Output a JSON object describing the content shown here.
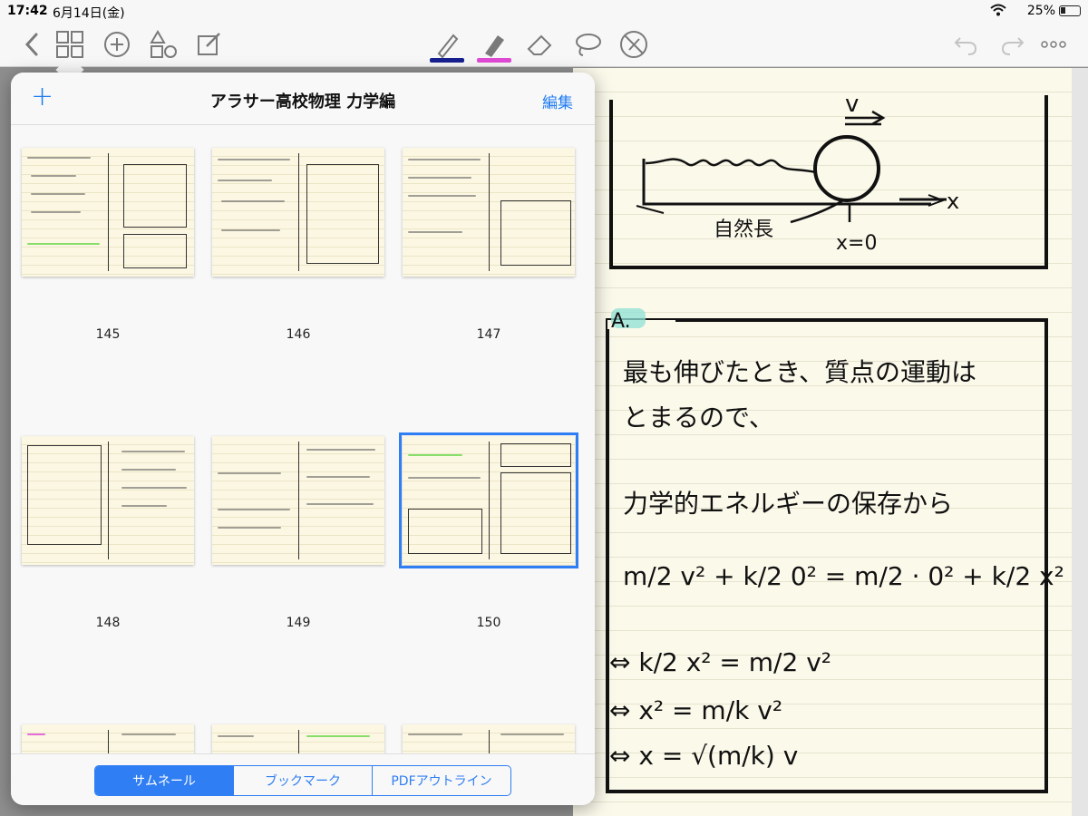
{
  "status_bar": {
    "time": "17:42",
    "date": "6月14日(金)",
    "battery": "25%"
  },
  "toolbar": {
    "icons": [
      "back-icon",
      "grid-icon",
      "add-page-icon",
      "shapes-icon",
      "edit-icon",
      "pen-icon",
      "highlighter-icon",
      "eraser-icon",
      "lasso-icon",
      "no-touch-icon",
      "undo-icon",
      "redo-icon",
      "more-icon"
    ],
    "pen_color": "#17208f",
    "highlighter_color": "#e04ad6"
  },
  "popover": {
    "add_label": "+",
    "title": "アラサー高校物理 力学編",
    "edit_label": "編集",
    "pages": [
      {
        "number": "145"
      },
      {
        "number": "146"
      },
      {
        "number": "147"
      },
      {
        "number": "148"
      },
      {
        "number": "149"
      },
      {
        "number": "150",
        "selected": true
      }
    ],
    "tabs": [
      {
        "label": "サムネール",
        "active": true
      },
      {
        "label": "ブックマーク",
        "active": false
      },
      {
        "label": "PDFアウトライン",
        "active": false
      }
    ]
  },
  "note": {
    "velocity_label": "v",
    "natural_length_label": "自然長",
    "position_label": "x=0",
    "axis_label": "x",
    "answer_marker": "A.",
    "line1": "最も伸びたとき、質点の運動は",
    "line2": "とまるので、",
    "line3": "力学的エネルギーの保存から",
    "eq1": "m/2 v² + k/2 0² = m/2 · 0² + k/2 x²",
    "eq2": "⇔ k/2 x² = m/2 v²",
    "eq3": "⇔ x² = m/k v²",
    "eq4": "⇔ x = √(m/k) v"
  }
}
